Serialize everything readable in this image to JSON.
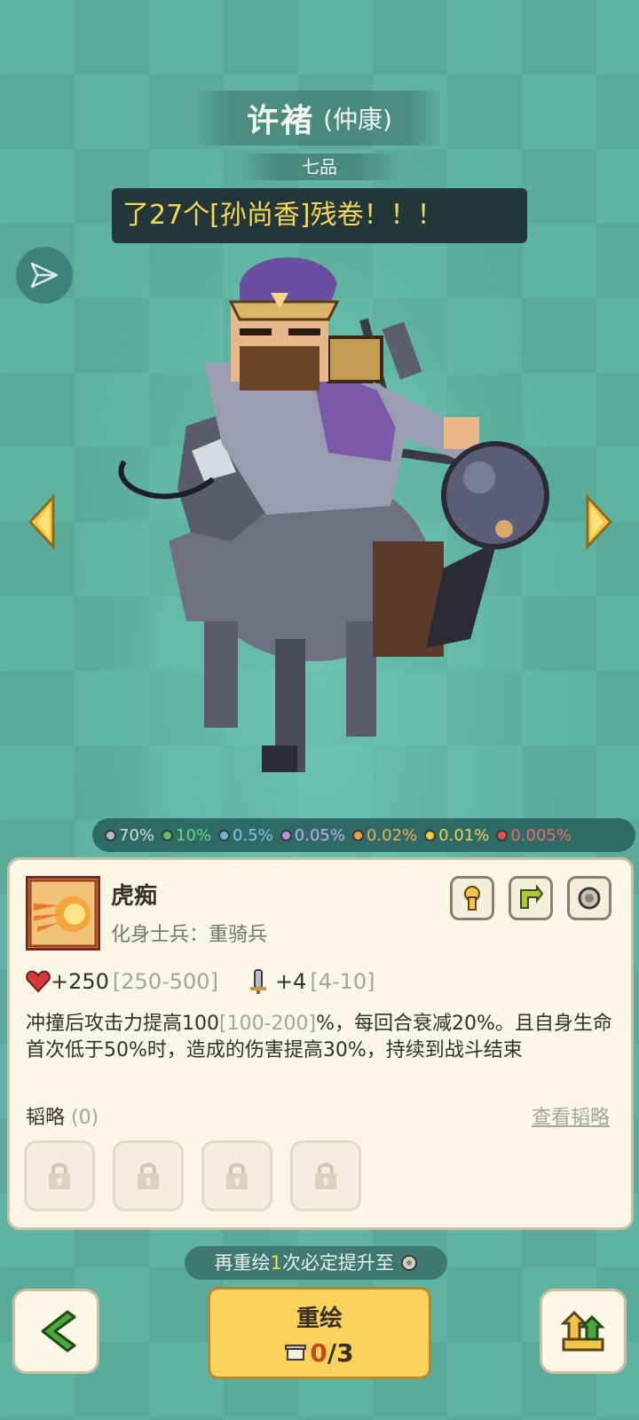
{
  "hero": {
    "name": "许褚",
    "courtesy": "(仲康)",
    "rank": "七品"
  },
  "marquee": {
    "text": "了27个[孙尚香]残卷！！！"
  },
  "probabilities": [
    {
      "value": "70%",
      "color": "#bdbdbd",
      "text_color": "#d7dbd7"
    },
    {
      "value": "10%",
      "color": "#5bc46a",
      "text_color": "#6fd37f"
    },
    {
      "value": "0.5%",
      "color": "#6fb4e0",
      "text_color": "#86c6ee"
    },
    {
      "value": "0.05%",
      "color": "#b795e0",
      "text_color": "#c7a8ef"
    },
    {
      "value": "0.02%",
      "color": "#f0a040",
      "text_color": "#f2ad55"
    },
    {
      "value": "0.01%",
      "color": "#f2cf3a",
      "text_color": "#f2d24c"
    },
    {
      "value": "0.005%",
      "color": "#e8514a",
      "text_color": "#ef6a5f"
    }
  ],
  "skill": {
    "name": "虎痴",
    "subtitle": "化身士兵：重骑兵",
    "hp": {
      "value": "+250",
      "range": "[250-500]"
    },
    "atk": {
      "value": "+4",
      "range": "[4-10]"
    },
    "desc": {
      "p1": "冲撞后攻击力提高100",
      "r1": "[100-200]",
      "p2": "%，每回合衰减20%。且自身生命首次低于50%时，造成的伤害提高30%，持续到战斗结束"
    },
    "icon_names": [
      "keyhole-icon",
      "swap-icon",
      "coin-icon"
    ]
  },
  "strategy": {
    "label": "韬略",
    "count": "(0)",
    "view_all": "查看韬略",
    "slot_count": 4
  },
  "hint": {
    "pre": "再重绘",
    "num": "1",
    "post": "次必定提升至"
  },
  "redraw": {
    "label": "重绘",
    "current": "0",
    "max": "/3"
  },
  "colors": {
    "accent": "#f8d25c",
    "card_bg": "#fbf6e6",
    "marquee_text": "#f5d655"
  }
}
